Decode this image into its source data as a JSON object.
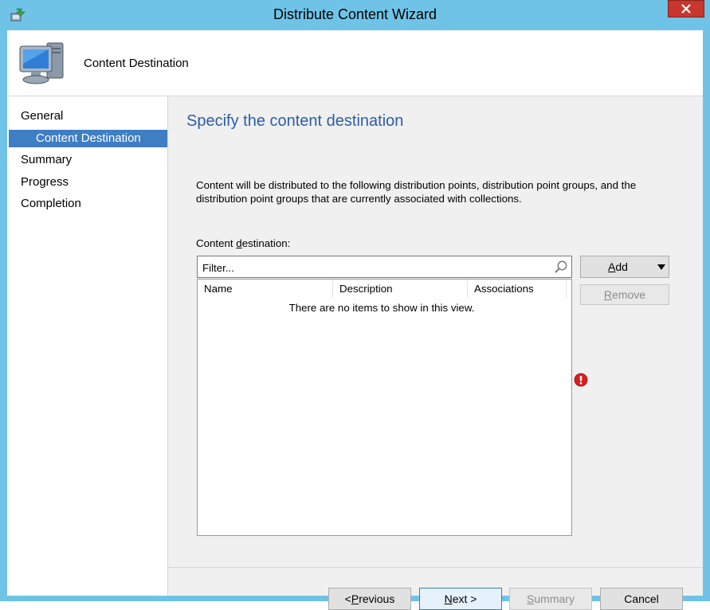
{
  "window": {
    "title": "Distribute Content Wizard",
    "app_icon": "wizard-icon",
    "close_icon": "close-icon"
  },
  "header": {
    "title": "Content Destination",
    "icon": "computer-icon"
  },
  "nav": {
    "items": [
      {
        "label": "General",
        "selected": false
      },
      {
        "label": "Content Destination",
        "selected": true
      },
      {
        "label": "Summary",
        "selected": false
      },
      {
        "label": "Progress",
        "selected": false
      },
      {
        "label": "Completion",
        "selected": false
      }
    ]
  },
  "main": {
    "page_title": "Specify the content destination",
    "description": "Content will be distributed to the following distribution points, distribution point groups, and the distribution point groups that are currently associated with collections.",
    "destination_label_pre": "Content ",
    "destination_label_accel": "d",
    "destination_label_post": "estination:",
    "filter_placeholder": "Filter...",
    "filter_value": "",
    "columns": [
      "Name",
      "Description",
      "Associations"
    ],
    "empty_text": "There are no items to show in this view.",
    "add_label_accel": "A",
    "add_label_rest": "dd",
    "remove_label_accel": "R",
    "remove_label_rest": "emove",
    "error_icon": "error-icon"
  },
  "footer": {
    "previous_pre": "< ",
    "previous_accel": "P",
    "previous_rest": "revious",
    "next_accel": "N",
    "next_rest": "ext >",
    "summary_accel": "S",
    "summary_rest": "ummary",
    "cancel_label": "Cancel"
  },
  "colors": {
    "title_bar": "#6fc3e6",
    "accent_title": "#2b5ea8",
    "selection": "#3e7ec3",
    "close": "#c7372f",
    "error": "#d81e1e"
  }
}
